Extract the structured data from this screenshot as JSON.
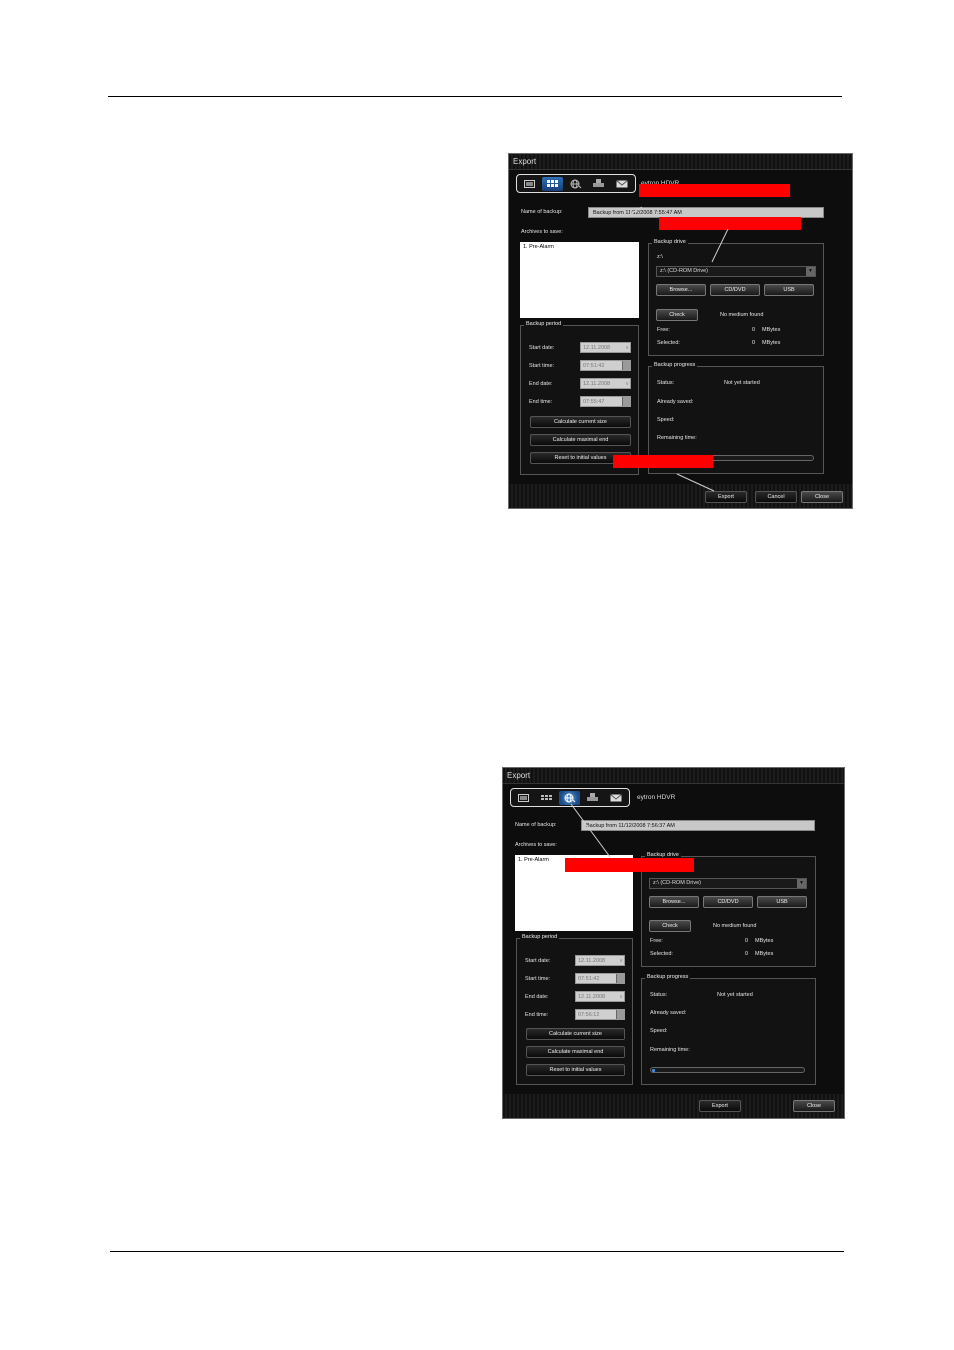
{
  "windows": [
    {
      "title": "Export",
      "system_name": "eytron HDVR",
      "name_label": "Name of backup:",
      "name_value": "Backup from 11/12/2008 7:55:47 AM",
      "archives_label": "Archives to save:",
      "archives": [
        "1. Pre-Alarm"
      ],
      "backup_drive": {
        "title": "Backup drive",
        "drive_letter": "z:\\",
        "selected": "z:\\ (CD-ROM Drive)",
        "browse": "Browse...",
        "cddvd": "CD/DVD",
        "usb": "USB",
        "check": "Check",
        "check_status": "No medium found",
        "free_label": "Free:",
        "free_value": "0",
        "free_unit": "MBytes",
        "selected_label": "Selected:",
        "selected_value": "0",
        "selected_unit": "MBytes"
      },
      "backup_period": {
        "title": "Backup period",
        "start_date_label": "Start date:",
        "start_date": "12.11.2008",
        "start_time_label": "Start time:",
        "start_time": "07:51:42",
        "end_date_label": "End date:",
        "end_date": "12.11.2008",
        "end_time_label": "End time:",
        "end_time": "07:55:47",
        "calc_size": "Calculate current size",
        "calc_end": "Calculate maximal end",
        "reset": "Reset to initial values"
      },
      "backup_progress": {
        "title": "Backup progress",
        "status_label": "Status:",
        "status_value": "Not yet started",
        "already_label": "Already saved:",
        "speed_label": "Speed:",
        "remaining_label": "Remaining time:",
        "progress": 0
      },
      "footer": {
        "export": "Export",
        "cancel": "Cancel",
        "close": "Close"
      }
    },
    {
      "title": "Export",
      "system_name": "eytron HDVR",
      "name_label": "Name of backup:",
      "name_value": "Backup from 11/12/2008 7:56:37 AM",
      "archives_label": "Archives to save:",
      "archives": [
        "1. Pre-Alarm"
      ],
      "backup_drive": {
        "title": "Backup drive",
        "selected": "z:\\ (CD-ROM Drive)",
        "browse": "Browse...",
        "cddvd": "CD/DVD",
        "usb": "USB",
        "check": "Check",
        "check_status": "No medium found",
        "free_label": "Free:",
        "free_value": "0",
        "free_unit": "MBytes",
        "selected_label": "Selected:",
        "selected_value": "0",
        "selected_unit": "MBytes"
      },
      "backup_period": {
        "title": "Backup period",
        "start_date_label": "Start date:",
        "start_date": "12.11.2008",
        "start_time_label": "Start time:",
        "start_time": "07:51:42",
        "end_date_label": "End date:",
        "end_date": "12.11.2008",
        "end_time_label": "End time:",
        "end_time": "07:56:12",
        "calc_size": "Calculate current size",
        "calc_end": "Calculate maximal end",
        "reset": "Reset to initial values"
      },
      "backup_progress": {
        "title": "Backup progress",
        "status_label": "Status:",
        "status_value": "Not yet started",
        "already_label": "Already saved:",
        "speed_label": "Speed:",
        "remaining_label": "Remaining time:",
        "progress": 0.01
      },
      "footer": {
        "export": "Export",
        "close": "Close"
      }
    }
  ],
  "colors": {
    "redaction": "#ff0000",
    "window_bg": "#0d0d0d",
    "active_tab": "#2d6fb8"
  },
  "icons": [
    "monitor-icon",
    "grid-icon",
    "globe-icon",
    "printer-icon",
    "envelope-icon"
  ]
}
